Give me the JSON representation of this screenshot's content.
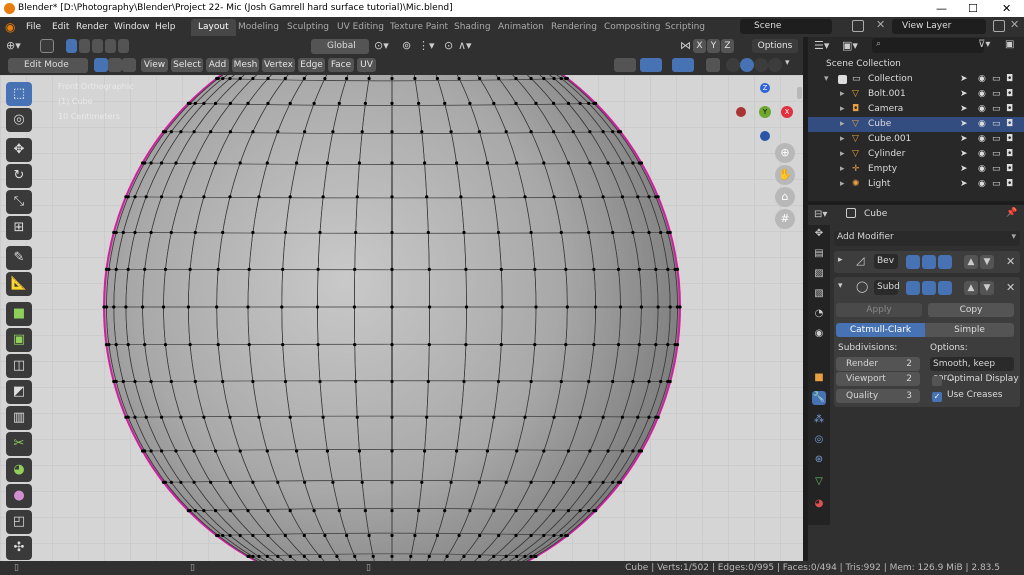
{
  "window": {
    "title": "Blender* [D:\\Photography\\Blender\\Project 22- Mic (Josh Gamrell hard surface tutorial)\\Mic.blend]",
    "min": "—",
    "max": "☐",
    "close": "✕"
  },
  "menus": [
    "File",
    "Edit",
    "Render",
    "Window",
    "Help"
  ],
  "workspaces": [
    "Layout",
    "Modeling",
    "Sculpting",
    "UV Editing",
    "Texture Paint",
    "Shading",
    "Animation",
    "Rendering",
    "Compositing",
    "Scripting"
  ],
  "scene": {
    "label": "Scene",
    "view_layer": "View Layer"
  },
  "viewport_header": {
    "orientation": "Global",
    "options": "Options",
    "axes": [
      "X",
      "Y",
      "Z"
    ]
  },
  "viewport_header2": {
    "mode": "Edit Mode",
    "menus": [
      "View",
      "Select",
      "Add",
      "Mesh",
      "Vertex",
      "Edge",
      "Face",
      "UV"
    ]
  },
  "overlay_text": {
    "view": "Front Orthographic",
    "object": "(1) Cube",
    "scale": "10 Centimeters"
  },
  "gizmo": {
    "z": "Z",
    "y": "Y",
    "x": "X"
  },
  "outliner": {
    "search_placeholder": "",
    "root": "Scene Collection",
    "collection": "Collection",
    "items": [
      {
        "name": "Bolt.001",
        "icon": "mesh-icon"
      },
      {
        "name": "Camera",
        "icon": "camera-icon"
      },
      {
        "name": "Cube",
        "icon": "mesh-icon",
        "selected": true
      },
      {
        "name": "Cube.001",
        "icon": "mesh-icon"
      },
      {
        "name": "Cylinder",
        "icon": "mesh-icon"
      },
      {
        "name": "Empty",
        "icon": "empty-icon"
      },
      {
        "name": "Light",
        "icon": "light-icon"
      }
    ]
  },
  "properties": {
    "object_name": "Cube",
    "add_modifier": "Add Modifier",
    "mod1": "Bev",
    "mod2": "Subd",
    "apply": "Apply",
    "copy": "Copy",
    "catmull": "Catmull-Clark",
    "simple": "Simple",
    "subdivisions": "Subdivisions:",
    "options": "Options:",
    "render_label": "Render",
    "render_val": "2",
    "viewport_label": "Viewport",
    "viewport_val": "2",
    "quality_label": "Quality",
    "quality_val": "3",
    "uv_smooth": "Smooth, keep cor...",
    "optimal_display": "Optimal Display",
    "optimal_display_checked": false,
    "use_creases": "Use Creases",
    "use_creases_checked": true
  },
  "status": {
    "text": "Cube | Verts:1/502 | Edges:0/995 | Faces:0/494 | Tris:992 | Mem: 126.9 MiB | 2.83.5"
  },
  "colors": {
    "accent": "#4772b3",
    "selection": "#334d80",
    "mesh_outline": "#d020a0"
  }
}
